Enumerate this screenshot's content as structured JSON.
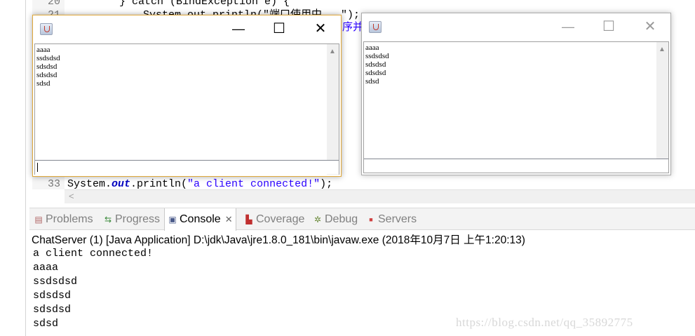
{
  "editor": {
    "line_20_no": "20",
    "line_20_text": "} catch (BindException e) {",
    "line_21_no": "21",
    "line_21_text": "System.out.println(\"端口使用中...\");",
    "line_fragment": "序并",
    "line_33_no": "33",
    "line_33_prefix": "System.",
    "line_33_field": "out",
    "line_33_mid": ".println(",
    "line_33_string": "\"a client connected!\"",
    "line_33_suffix": ");",
    "scroll_left_icon": "chevron-left-icon"
  },
  "client_window_1": {
    "title_icon": "java-cup-icon",
    "minimize_glyph": "—",
    "maximize_glyph": "☐",
    "close_glyph": "✕",
    "lines": [
      "aaaa",
      "ssdsdsd",
      "sdsdsd",
      "sdsdsd",
      "sdsd"
    ],
    "input_value": "",
    "border_color": "#e0a83a"
  },
  "client_window_2": {
    "title_icon": "java-cup-icon",
    "minimize_glyph": "—",
    "maximize_glyph": "☐",
    "close_glyph": "✕",
    "lines": [
      "aaaa",
      "ssdsdsd",
      "sdsdsd",
      "sdsdsd",
      "sdsd"
    ],
    "input_value": ""
  },
  "console_view": {
    "tabs": [
      {
        "label": "Problems",
        "icon": "problems-icon",
        "icon_glyph": "▤",
        "icon_color": "#b06464"
      },
      {
        "label": "Progress",
        "icon": "progress-icon",
        "icon_glyph": "⇆",
        "icon_color": "#3a8a3a"
      },
      {
        "label": "Console",
        "icon": "console-icon",
        "icon_glyph": "▣",
        "icon_color": "#4a5a8a",
        "close_glyph": "✕"
      },
      {
        "label": "Coverage",
        "icon": "coverage-icon",
        "icon_glyph": "▙",
        "icon_color": "#c03030"
      },
      {
        "label": "Debug",
        "icon": "debug-icon",
        "icon_glyph": "✲",
        "icon_color": "#6a8a3a"
      },
      {
        "label": "Servers",
        "icon": "servers-icon",
        "icon_glyph": "■",
        "icon_color": "#d04040"
      }
    ],
    "description": "ChatServer (1) [Java Application] D:\\jdk\\Java\\jre1.8.0_181\\bin\\javaw.exe (2018年10月7日 上午1:20:13)",
    "output_lines": [
      "a client connected!",
      "aaaa",
      "ssdsdsd",
      "sdsdsd",
      "sdsdsd",
      "sdsd"
    ]
  },
  "watermark": "https://blog.csdn.net/qq_35892775"
}
